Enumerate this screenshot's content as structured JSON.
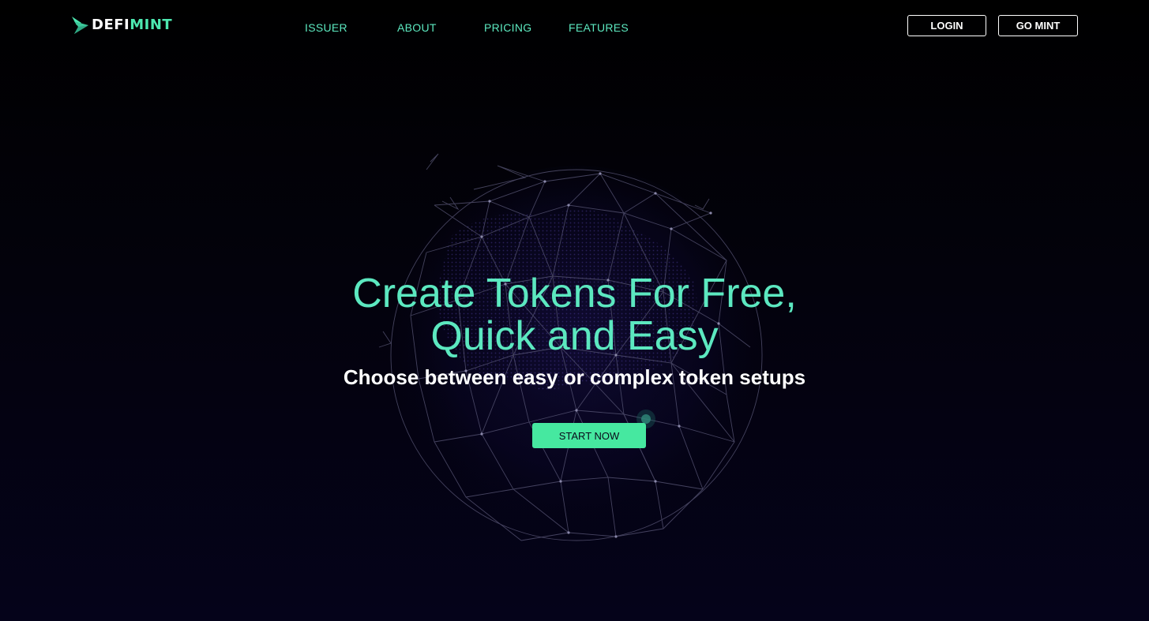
{
  "brand": {
    "name_part1": "DEFI",
    "name_part2": "MINT",
    "accent_color": "#4de8b0"
  },
  "nav": {
    "items": [
      {
        "label": "ISSUER"
      },
      {
        "label": "ABOUT"
      },
      {
        "label": "PRICING"
      },
      {
        "label": "FEATURES"
      }
    ]
  },
  "header_actions": {
    "login_label": "LOGIN",
    "go_mint_label": "GO MINT"
  },
  "hero": {
    "title_line1": "Create Tokens For Free,",
    "title_line2": "Quick and Easy",
    "subtitle": "Choose between easy or complex token setups",
    "cta_label": "START NOW",
    "title_color": "#5ce8c0",
    "cta_color": "#46e8a0"
  },
  "background": {
    "graphic": "network-globe",
    "colors": [
      "#000000",
      "#05031a"
    ]
  }
}
